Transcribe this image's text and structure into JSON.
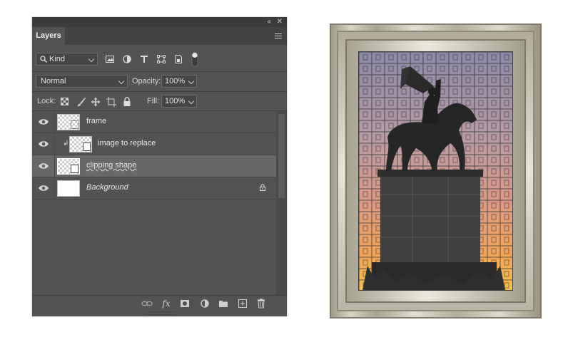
{
  "panel": {
    "tab_title": "Layers",
    "filter_label": "Kind",
    "blend_mode": "Normal",
    "opacity_label": "Opacity:",
    "opacity_value": "100%",
    "lock_label": "Lock:",
    "fill_label": "Fill:",
    "fill_value": "100%",
    "layers": [
      {
        "name": "frame",
        "selected": false
      },
      {
        "name": "image to replace",
        "clipped": true,
        "selected": false
      },
      {
        "name": "clipping shape",
        "selected": true
      },
      {
        "name": "Background",
        "locked": true,
        "selected": false
      }
    ],
    "icons": {
      "collapse": "double-chevron-icon",
      "close": "close-icon",
      "menu": "hamburger-icon",
      "search": "search-icon",
      "filters": [
        "pixel-layer-filter-icon",
        "adjustment-filter-icon",
        "type-filter-icon",
        "shape-filter-icon",
        "smart-object-filter-icon",
        "filter-toggle-icon"
      ],
      "locks": [
        "lock-transparent-icon",
        "lock-paint-icon",
        "lock-position-icon",
        "lock-artboard-icon",
        "lock-all-icon"
      ],
      "bottom": [
        "link-icon",
        "fx-icon",
        "mask-icon",
        "adjustment-icon",
        "folder-icon",
        "new-layer-icon",
        "trash-icon"
      ]
    }
  },
  "colors": {
    "panel_bg": "#535353",
    "selected_row": "#686868",
    "tabbar": "#424242"
  }
}
